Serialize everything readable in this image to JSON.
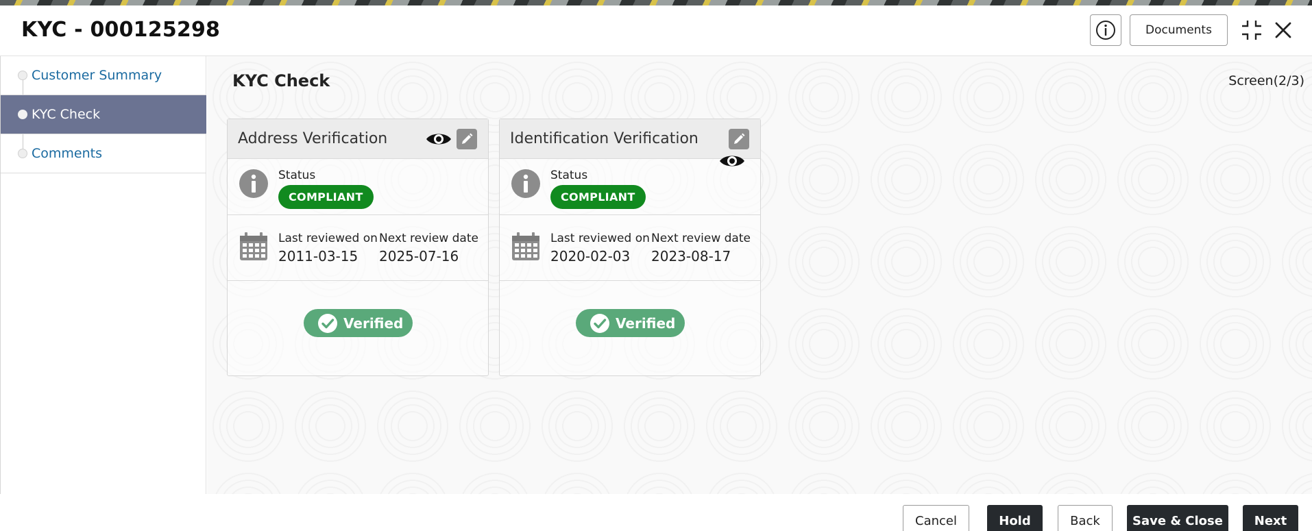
{
  "window": {
    "title": "KYC - 000125298"
  },
  "header": {
    "documents_label": "Documents"
  },
  "sidebar": {
    "items": [
      {
        "label": "Customer Summary",
        "active": false
      },
      {
        "label": "KYC Check",
        "active": true
      },
      {
        "label": "Comments",
        "active": false
      }
    ]
  },
  "main": {
    "section_title": "KYC Check",
    "screen_indicator": "Screen(2/3)",
    "cards": [
      {
        "title": "Address Verification",
        "status_label": "Status",
        "status": "COMPLIANT",
        "last_reviewed_label": "Last reviewed on",
        "last_reviewed": "2011-03-15",
        "next_review_label": "Next review date",
        "next_review": "2025-07-16",
        "verified_label": "Verified"
      },
      {
        "title": "Identification Verification",
        "status_label": "Status",
        "status": "COMPLIANT",
        "last_reviewed_label": "Last reviewed on",
        "last_reviewed": "2020-02-03",
        "next_review_label": "Next review date",
        "next_review": "2023-08-17",
        "verified_label": "Verified"
      }
    ]
  },
  "footer": {
    "cancel": "Cancel",
    "hold": "Hold",
    "back": "Back",
    "save_close": "Save & Close",
    "next": "Next"
  },
  "colors": {
    "sidebar_active": "#6b7392",
    "compliant_badge": "#118a1f",
    "verified_badge": "#5aa97a",
    "primary_button": "#262a2e",
    "link": "#1a6aa0"
  },
  "icons": [
    "info-icon",
    "collapse-icon",
    "close-icon",
    "eye-icon",
    "edit-icon",
    "info-circle-icon",
    "calendar-icon",
    "check-circle-icon"
  ]
}
